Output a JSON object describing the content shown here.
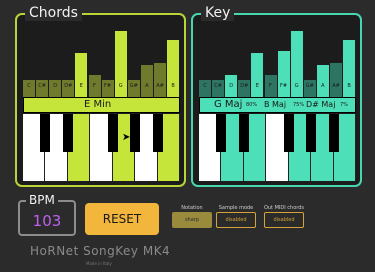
{
  "chords_panel": {
    "title": "Chords",
    "chord": "E Min",
    "notes": [
      {
        "label": "C",
        "level": 0.24,
        "color": "#6f7a2c"
      },
      {
        "label": "C#",
        "level": 0.24,
        "color": "#6f7a2c"
      },
      {
        "label": "D",
        "level": 0.24,
        "color": "#6f7a2c"
      },
      {
        "label": "D#",
        "level": 0.24,
        "color": "#6f7a2c"
      },
      {
        "label": "E",
        "level": 0.63,
        "color": "#c6e53b"
      },
      {
        "label": "F",
        "level": 0.32,
        "color": "#6f7a2c"
      },
      {
        "label": "F#",
        "level": 0.24,
        "color": "#6f7a2c"
      },
      {
        "label": "G",
        "level": 0.94,
        "color": "#c6e53b"
      },
      {
        "label": "G#",
        "level": 0.24,
        "color": "#6f7a2c"
      },
      {
        "label": "A",
        "level": 0.46,
        "color": "#6f7a2c"
      },
      {
        "label": "A#",
        "level": 0.49,
        "color": "#6f7a2c"
      },
      {
        "label": "B",
        "level": 0.81,
        "color": "#c6e53b"
      }
    ],
    "keys_active": [
      "E",
      "G",
      "B"
    ],
    "active_color": "#c6e53b"
  },
  "key_panel": {
    "title": "Key",
    "primary_key": "G Maj",
    "primary_pct": "80%",
    "alt1_key": "B Maj",
    "alt1_pct": "75%",
    "alt2_key": "D# Maj",
    "alt2_pct": "7%",
    "notes": [
      {
        "label": "C",
        "level": 0.24,
        "color": "#2e7462"
      },
      {
        "label": "C#",
        "level": 0.24,
        "color": "#2e7462"
      },
      {
        "label": "D",
        "level": 0.32,
        "color": "#4de0b8"
      },
      {
        "label": "D#",
        "level": 0.24,
        "color": "#2e7462"
      },
      {
        "label": "E",
        "level": 0.63,
        "color": "#4de0b8"
      },
      {
        "label": "F",
        "level": 0.32,
        "color": "#2e7462"
      },
      {
        "label": "F#",
        "level": 0.65,
        "color": "#4de0b8"
      },
      {
        "label": "G",
        "level": 0.94,
        "color": "#4de0b8"
      },
      {
        "label": "G#",
        "level": 0.24,
        "color": "#2e7462"
      },
      {
        "label": "A",
        "level": 0.46,
        "color": "#4de0b8"
      },
      {
        "label": "A#",
        "level": 0.49,
        "color": "#2e7462"
      },
      {
        "label": "B",
        "level": 0.81,
        "color": "#4de0b8"
      }
    ],
    "keys_active": [
      "D",
      "E",
      "F#",
      "G",
      "A",
      "B"
    ],
    "active_color": "#4de0b8"
  },
  "bpm": {
    "title": "BPM",
    "value": "103"
  },
  "reset_label": "RESET",
  "options": {
    "notation": {
      "label": "Notation",
      "value": "sharp"
    },
    "sample_mode": {
      "label": "Sample mode",
      "value": "disabled"
    },
    "out_midi": {
      "label": "Out MIDI chords",
      "value": "disabled"
    }
  },
  "brand": {
    "name": "HoRNet SongKey MK4",
    "made": "Made in Italy"
  }
}
